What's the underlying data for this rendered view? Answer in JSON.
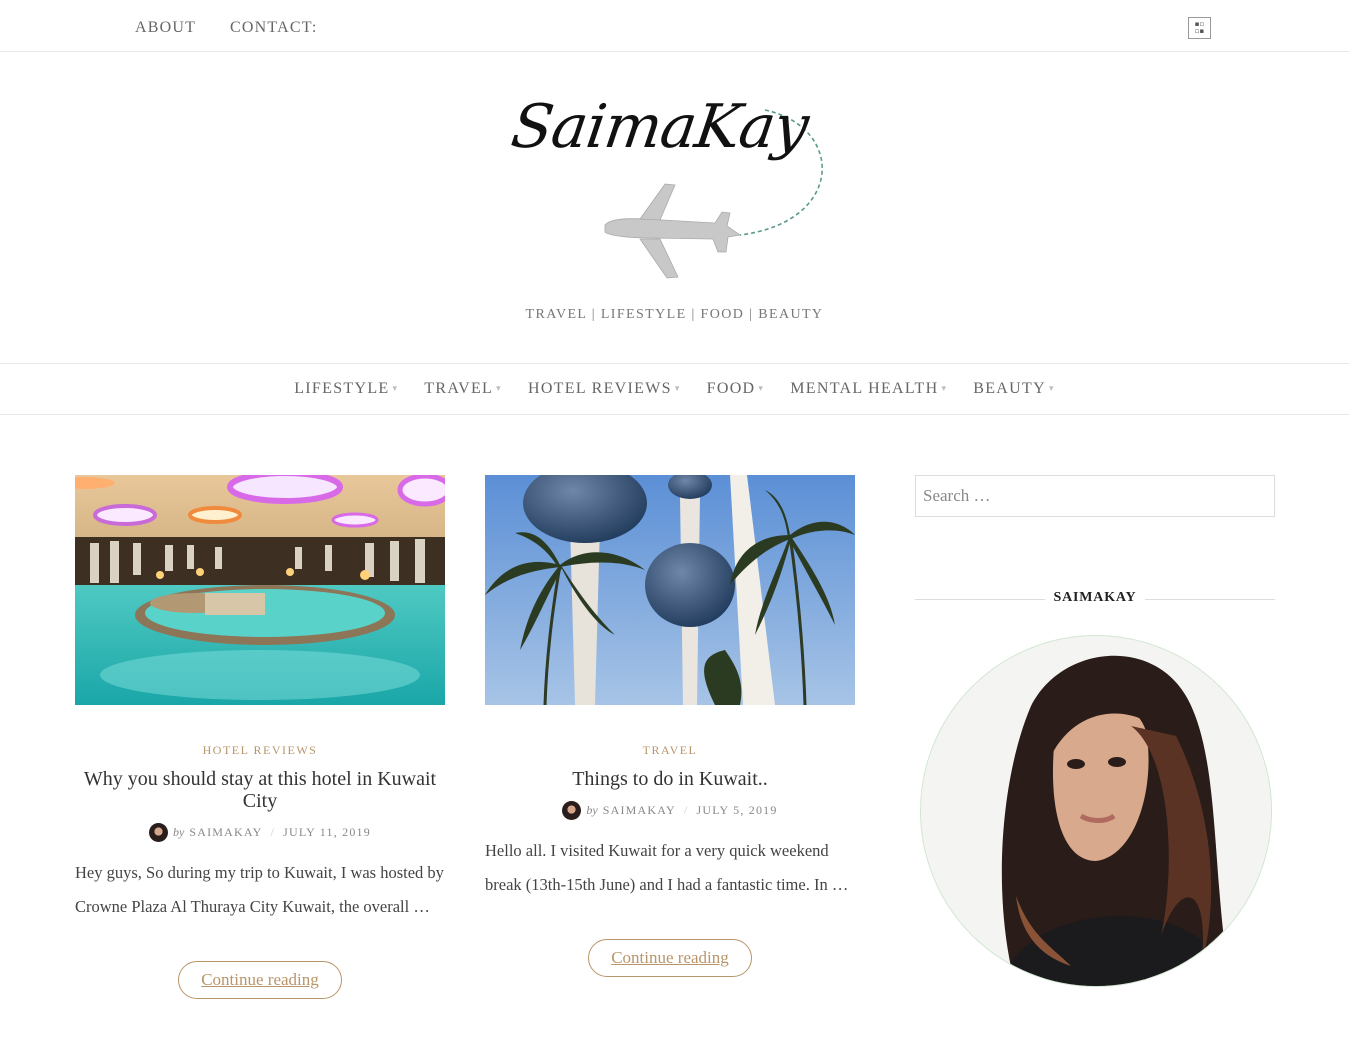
{
  "topbar": {
    "about": "ABOUT",
    "contact": "CONTACT:",
    "icon": "flag-icon"
  },
  "logo": {
    "text": "SaimaKay",
    "icon": "airplane-icon"
  },
  "tagline": "TRAVEL | LIFESTYLE | FOOD | BEAUTY",
  "nav": [
    {
      "label": "LIFESTYLE"
    },
    {
      "label": "TRAVEL"
    },
    {
      "label": "HOTEL REVIEWS"
    },
    {
      "label": "FOOD"
    },
    {
      "label": "MENTAL HEALTH"
    },
    {
      "label": "BEAUTY"
    }
  ],
  "posts": [
    {
      "category": "HOTEL REVIEWS",
      "title": "Why you should stay at this hotel in Kuwait City",
      "by": "by",
      "author": "SAIMAKAY",
      "date": "JULY 11, 2019",
      "excerpt": "Hey guys, So during my trip to Kuwait, I was hosted by Crowne Plaza Al Thuraya City Kuwait, the overall …",
      "more": "Continue reading"
    },
    {
      "category": "TRAVEL",
      "title": "Things to do in Kuwait..",
      "by": "by",
      "author": "SAIMAKAY",
      "date": "JULY 5, 2019",
      "excerpt": "Hello all. I visited Kuwait for a very quick weekend break (13th-15th June) and I had a fantastic time.  In …",
      "more": "Continue reading"
    }
  ],
  "sidebar": {
    "search_placeholder": "Search …",
    "widget_title": "SAIMAKAY"
  },
  "colors": {
    "accent": "#b8956a",
    "text": "#444444",
    "border": "#e8e8e8"
  }
}
